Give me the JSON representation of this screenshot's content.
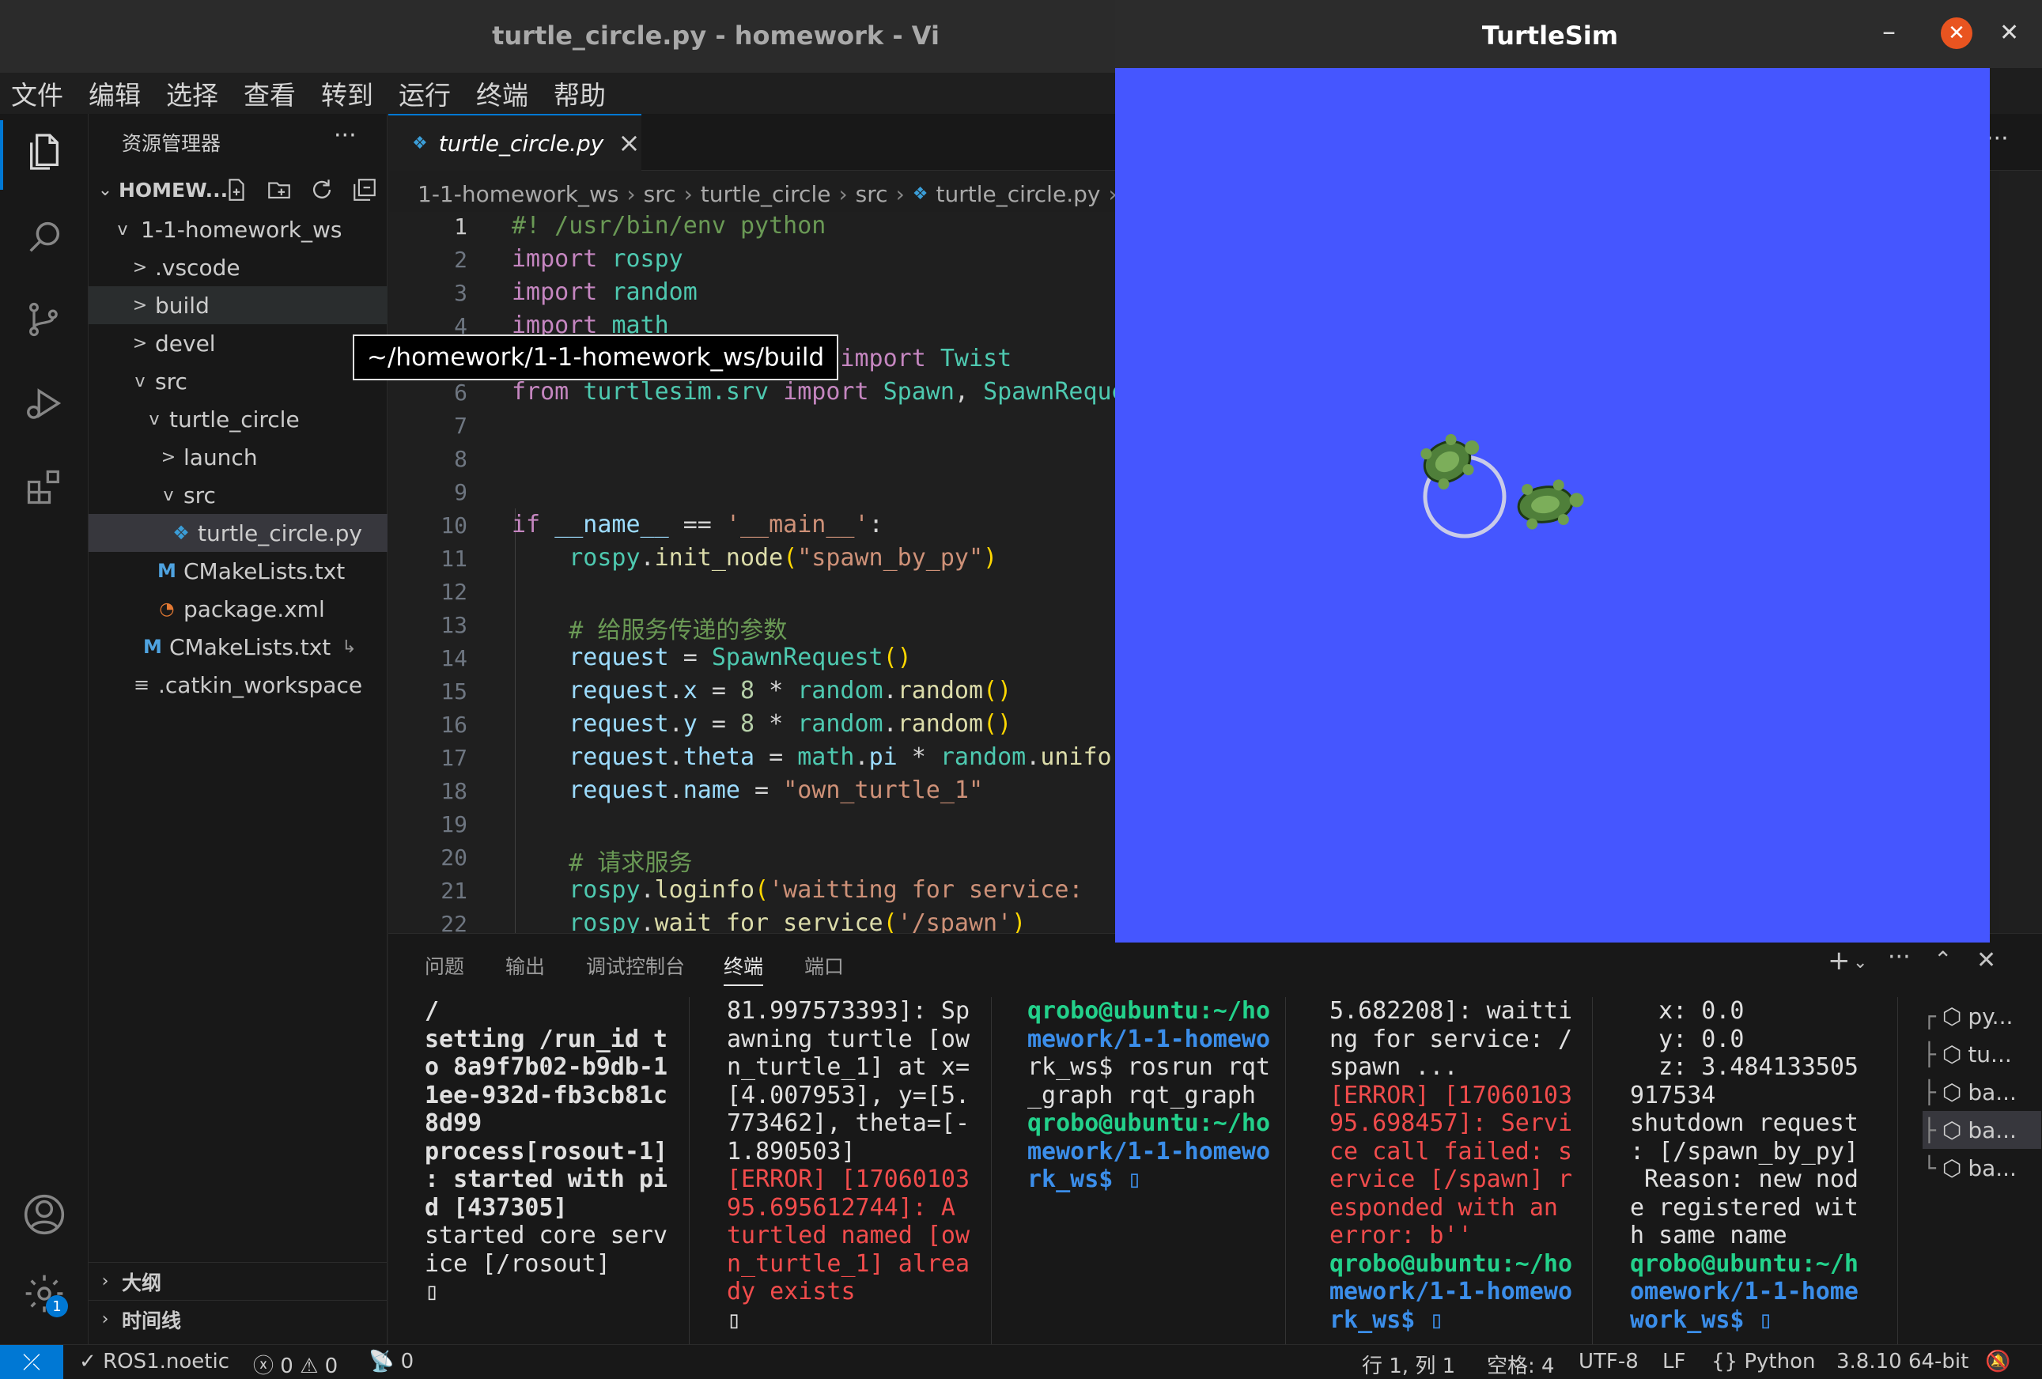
{
  "vscode": {
    "window_title": "turtle_circle.py - homework - Vi",
    "menu": [
      "文件",
      "编辑",
      "选择",
      "查看",
      "转到",
      "运行",
      "终端",
      "帮助"
    ],
    "explorer_title": "资源管理器",
    "explorer_more": "···",
    "workspace_name": "HOMEW...",
    "tree": [
      {
        "label": "1-1-homework_ws",
        "chev": "v",
        "icon": ""
      },
      {
        "label": ".vscode",
        "chev": ">",
        "icon": ""
      },
      {
        "label": "build",
        "chev": ">",
        "icon": ""
      },
      {
        "label": "devel",
        "chev": ">",
        "icon": ""
      },
      {
        "label": "src",
        "chev": "v",
        "icon": ""
      },
      {
        "label": "turtle_circle",
        "chev": "v",
        "icon": ""
      },
      {
        "label": "launch",
        "chev": ">",
        "icon": ""
      },
      {
        "label": "src",
        "chev": "v",
        "icon": ""
      },
      {
        "label": "turtle_circle.py",
        "chev": "",
        "icon": "python-icon"
      },
      {
        "label": "CMakeLists.txt",
        "chev": "",
        "icon": "cmake-icon"
      },
      {
        "label": "package.xml",
        "chev": "",
        "icon": "rss-icon"
      },
      {
        "label": "CMakeLists.txt",
        "chev": "",
        "icon": "cmake-icon"
      },
      {
        "label": ".catkin_workspace",
        "chev": "",
        "icon": "lines-icon"
      }
    ],
    "outline_label": "大纲",
    "timeline_label": "时间线",
    "tooltip": "~/homework/1-1-homework_ws/build",
    "tab": {
      "label": "turtle_circle.py",
      "close": "×"
    },
    "breadcrumb": [
      "1-1-homework_ws",
      "src",
      "turtle_circle",
      "src",
      "turtle_circle.py"
    ],
    "line_numbers": [
      "1",
      "2",
      "3",
      "4",
      "5",
      "6",
      "7",
      "8",
      "9",
      "10",
      "11",
      "12",
      "13",
      "14",
      "15",
      "16",
      "17",
      "18",
      "19",
      "20",
      "21",
      "22"
    ],
    "panel_tabs": [
      "问题",
      "输出",
      "调试控制台",
      "终端",
      "端口"
    ],
    "active_panel_tab": "终端",
    "terminals": {
      "t1": [
        "/",
        "",
        "setting /run_id t",
        "o 8a9f7b02-b9db-1",
        "1ee-932d-fb3cb81c",
        "8d99",
        "process[rosout-1]",
        ": started with pi",
        "d [437305]",
        "started core serv",
        "ice [/rosout]",
        "▯"
      ],
      "t2": [
        "81.997573393]: Sp",
        "awning turtle [ow",
        "n_turtle_1] at x=",
        "[4.007953], y=[5.",
        "773462], theta=[-",
        "1.890503]",
        "[ERROR] [17060103",
        "95.695612744]: A ",
        "turtled named [ow",
        "n_turtle_1] alrea",
        "dy exists",
        "▯"
      ],
      "t3": [
        "qrobo@ubuntu:~/ho",
        "mework/1-1-homewo",
        "rk_ws$ rosrun rqt",
        "_graph rqt_graph",
        "qrobo@ubuntu:~/ho",
        "mework/1-1-homewo",
        "rk_ws$ ▯"
      ],
      "t4": [
        "5.682208]: waitti",
        "ng for service: /",
        "spawn ...",
        "[ERROR] [17060103",
        "95.698457]: Servi",
        "ce call failed: s",
        "ervice [/spawn] r",
        "esponded with an ",
        "error: b''",
        "qrobo@ubuntu:~/ho",
        "mework/1-1-homewo",
        "rk_ws$ ▯"
      ],
      "t5": [
        "  x: 0.0",
        "  y: 0.0",
        "  z: 3.484133505",
        "917534",
        "shutdown request",
        ": [/spawn_by_py]",
        " Reason: new nod",
        "e registered wit",
        "h same name",
        "qrobo@ubuntu:~/h",
        "omework/1-1-home",
        "work_ws$ ▯"
      ]
    },
    "terminal_list": [
      "py...",
      "tu...",
      "ba...",
      "ba...",
      "ba..."
    ],
    "status": {
      "profile": "ROS1.noetic",
      "errors": "0",
      "warnings": "0",
      "ports": "0",
      "position": "行 1, 列 1",
      "spaces": "空格: 4",
      "encoding": "UTF-8",
      "eol": "LF",
      "language": "Python",
      "interpreter": "3.8.10 64-bit"
    }
  },
  "turtlesim": {
    "title": "TurtleSim",
    "minimize": "–",
    "close": "✕",
    "background_color": "#4556ff"
  },
  "colors": {
    "accent": "#0078d4",
    "error": "#f14c4c",
    "prompt_user": "#23d18b",
    "prompt_path": "#3b8eea"
  }
}
